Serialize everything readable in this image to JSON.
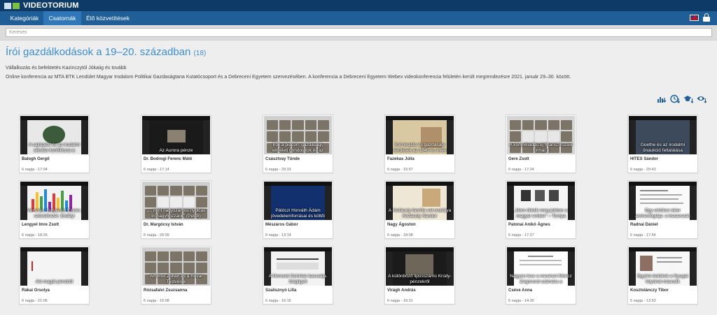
{
  "header": {
    "logo_text": "VIDEOTORIUM",
    "nav": [
      {
        "label": "Kategóriák",
        "active": false
      },
      {
        "label": "Csatornák",
        "active": true
      },
      {
        "label": "Élő közvetítések",
        "active": false
      }
    ],
    "icons": [
      "flag-icon",
      "lock-icon"
    ]
  },
  "search": {
    "placeholder": "Keresés"
  },
  "page": {
    "title": "Írói gazdálkodások a 19–20. században",
    "count": "(18)",
    "subtitle": "Vállalkozás és befektetés Kazinczytól Jókaiig és tovább",
    "description": "Online konferencia az MTA BTK Lendület Magyar Irodalom Politikai Gazdaságtana Kutatócsoport és a Debreceni Egyetem szervezésében. A konferencia a Debreceni Egyetem Webex videokonferencia felületén került megrendezésre 2021. január 29–30. között."
  },
  "toolbar": [
    "bar-chart-icon",
    "clock-icon",
    "graduation-cap-icon",
    "eye-icon"
  ],
  "colors": {
    "header": "#0d3a66",
    "nav": "#1f5e97",
    "nav_active": "#2f77b8",
    "title": "#3b8fd0",
    "background": "#eeeeee"
  },
  "videos": [
    {
      "caption": "A sajtópiac és az irodalmi alkotás konfliktusa a",
      "name": "Balogh Gergő",
      "meta": "6 napja - 17:04"
    },
    {
      "caption": "Az Aurora pénze",
      "name": "Dr. Bodrogi Ferenc Máté",
      "meta": "6 napja - 17:14"
    },
    {
      "caption": "Írók a piacon: gazdasági, elméleti gondolatok és az",
      "name": "Császtvay Tünde",
      "meta": "6 napja - 29:33"
    },
    {
      "caption": "Írói hivatás és gazdasági kérdések az 1840-es évek",
      "name": "Fazekas Júlia",
      "meta": "6 napja - 15:57"
    },
    {
      "caption": "A könyvkiadás új finanszírozási formái a",
      "name": "Gere Zsolt",
      "meta": "6 napja - 17:24"
    },
    {
      "caption": "Goethe és az irodalmi önaukció feltalálása",
      "name": "HITES Sándor",
      "meta": "6 napja - 20:43"
    },
    {
      "caption": "Versírás, Sulyánszi Eszter, szövetkezet. Erdélyi",
      "name": "Lengyel Imre Zsolt",
      "meta": "6 napja - 18:26"
    },
    {
      "caption": "„... mint nagyszámos nyolcas írónagyhozzánk” (Petőfi)",
      "name": "Dr. Margócsy István",
      "meta": "6 napja - 26:09"
    },
    {
      "caption": "Pálóczi Horváth Ádám jövedelemforrásai és költői",
      "name": "Mészáros Gábor",
      "meta": "6 napja - 13:14"
    },
    {
      "caption": "A Kisfaludy-família vet osztálya Kisfaludy Sándor",
      "name": "Nagy Ágoston",
      "meta": "6 napja - 18:08"
    },
    {
      "caption": "„Nem öltetik meg jobban a magyar ember” – Tompa",
      "name": "Patonai Anikó Ágnes",
      "meta": "6 napja - 17:27"
    },
    {
      "caption": "Egy erkölcsi siker archeológiája: a tiszaeszári",
      "name": "Radnai Dániel",
      "meta": "6 napja - 17:54"
    },
    {
      "caption": "Aki magát pénzből",
      "name": "Rákai Orsolya",
      "meta": "6 napja - 21:06"
    },
    {
      "caption": "Ambrus Zoltán és a Révai Testvérek",
      "name": "Rózsafalvi Zsuzsanna",
      "meta": "6 napja - 15:08"
    },
    {
      "caption": "A Nemzeti Színház kasszája. Szigligeti",
      "name": "Szalisznyó Lilla",
      "meta": "6 napja - 16:15"
    },
    {
      "caption": "A különböző lipusszámú Krúdy-pénzekről",
      "name": "Virágh András",
      "meta": "6 napja - 16:31"
    },
    {
      "caption": "Nagyon lesz a meséset Móricz Zsigmond számára a",
      "name": "Cséve Anna",
      "meta": "5 napja - 14:30"
    },
    {
      "caption": "Egyéni érdekek a Nyugat folyóirat második",
      "name": "Kosztolánczy Tibor",
      "meta": "5 napja - 13:53"
    }
  ]
}
